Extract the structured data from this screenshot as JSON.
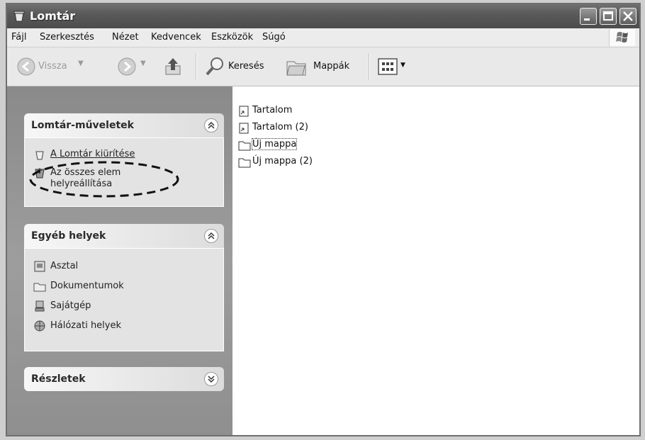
{
  "window": {
    "title": "Lomtár"
  },
  "menu": {
    "items": [
      "Fájl",
      "Szerkesztés",
      "Nézet",
      "Kedvencek",
      "Eszközök",
      "Súgó"
    ]
  },
  "toolbar": {
    "back_label": "Vissza",
    "search_label": "Keresés",
    "folders_label": "Mappák"
  },
  "left_pane": {
    "panels": [
      {
        "title": "Lomtár-műveletek",
        "tasks": [
          "A Lomtár kiürítése",
          "Az összes elem helyreállítása"
        ]
      },
      {
        "title": "Egyéb helyek",
        "tasks": [
          "Asztal",
          "Dokumentumok",
          "Sajátgép",
          "Hálózati helyek"
        ]
      },
      {
        "title": "Részletek",
        "tasks": []
      }
    ]
  },
  "files": [
    "Tartalom",
    "Tartalom (2)",
    "Új mappa",
    "Új mappa (2)"
  ]
}
